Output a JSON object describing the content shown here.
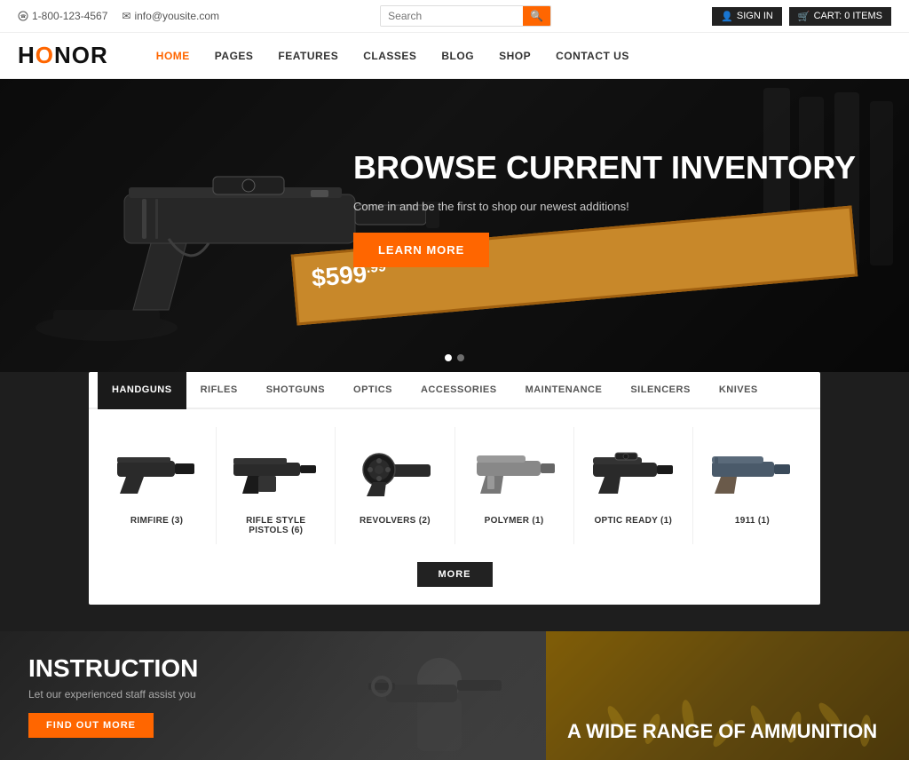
{
  "topbar": {
    "phone": "1-800-123-4567",
    "email": "info@yousite.com",
    "search_placeholder": "Search",
    "signin_label": "SIGN IN",
    "cart_label": "CART: 0 ITEMS"
  },
  "navbar": {
    "logo_text_1": "H",
    "logo_text_2": "N",
    "logo_middle": "O",
    "logo_full": "HONOR",
    "nav_items": [
      {
        "label": "HOME",
        "active": true
      },
      {
        "label": "PAGES",
        "active": false
      },
      {
        "label": "FEATURES",
        "active": false
      },
      {
        "label": "CLASSES",
        "active": false
      },
      {
        "label": "BLOG",
        "active": false
      },
      {
        "label": "SHOP",
        "active": false
      },
      {
        "label": "CONTACT US",
        "active": false
      }
    ]
  },
  "hero": {
    "title": "BROWSE CURRENT INVENTORY",
    "subtitle": "Come in and be the first to shop our newest additions!",
    "cta_label": "LEARN MORE",
    "price": "$599",
    "price_cents": "99",
    "dots": [
      true,
      false
    ]
  },
  "products": {
    "tabs": [
      {
        "label": "HANDGUNS",
        "active": true
      },
      {
        "label": "RIFLES",
        "active": false
      },
      {
        "label": "SHOTGUNS",
        "active": false
      },
      {
        "label": "OPTICS",
        "active": false
      },
      {
        "label": "ACCESSORIES",
        "active": false
      },
      {
        "label": "MAINTENANCE",
        "active": false
      },
      {
        "label": "SILENCERS",
        "active": false
      },
      {
        "label": "KNIVES",
        "active": false
      }
    ],
    "items": [
      {
        "name": "RIMFIRE (3)"
      },
      {
        "name": "RIFLE STYLE PISTOLS (6)"
      },
      {
        "name": "REVOLVERS (2)"
      },
      {
        "name": "POLYMER (1)"
      },
      {
        "name": "OPTIC READY (1)"
      },
      {
        "name": "1911 (1)"
      }
    ],
    "more_label": "MORE"
  },
  "banners": {
    "instruction": {
      "title": "INSTRUCTION",
      "subtitle": "Let our experienced staff assist you",
      "cta_label": "FIND OUT MORE"
    },
    "ammo": {
      "title": "A WIDE RANGE OF AMMUNITION"
    }
  }
}
